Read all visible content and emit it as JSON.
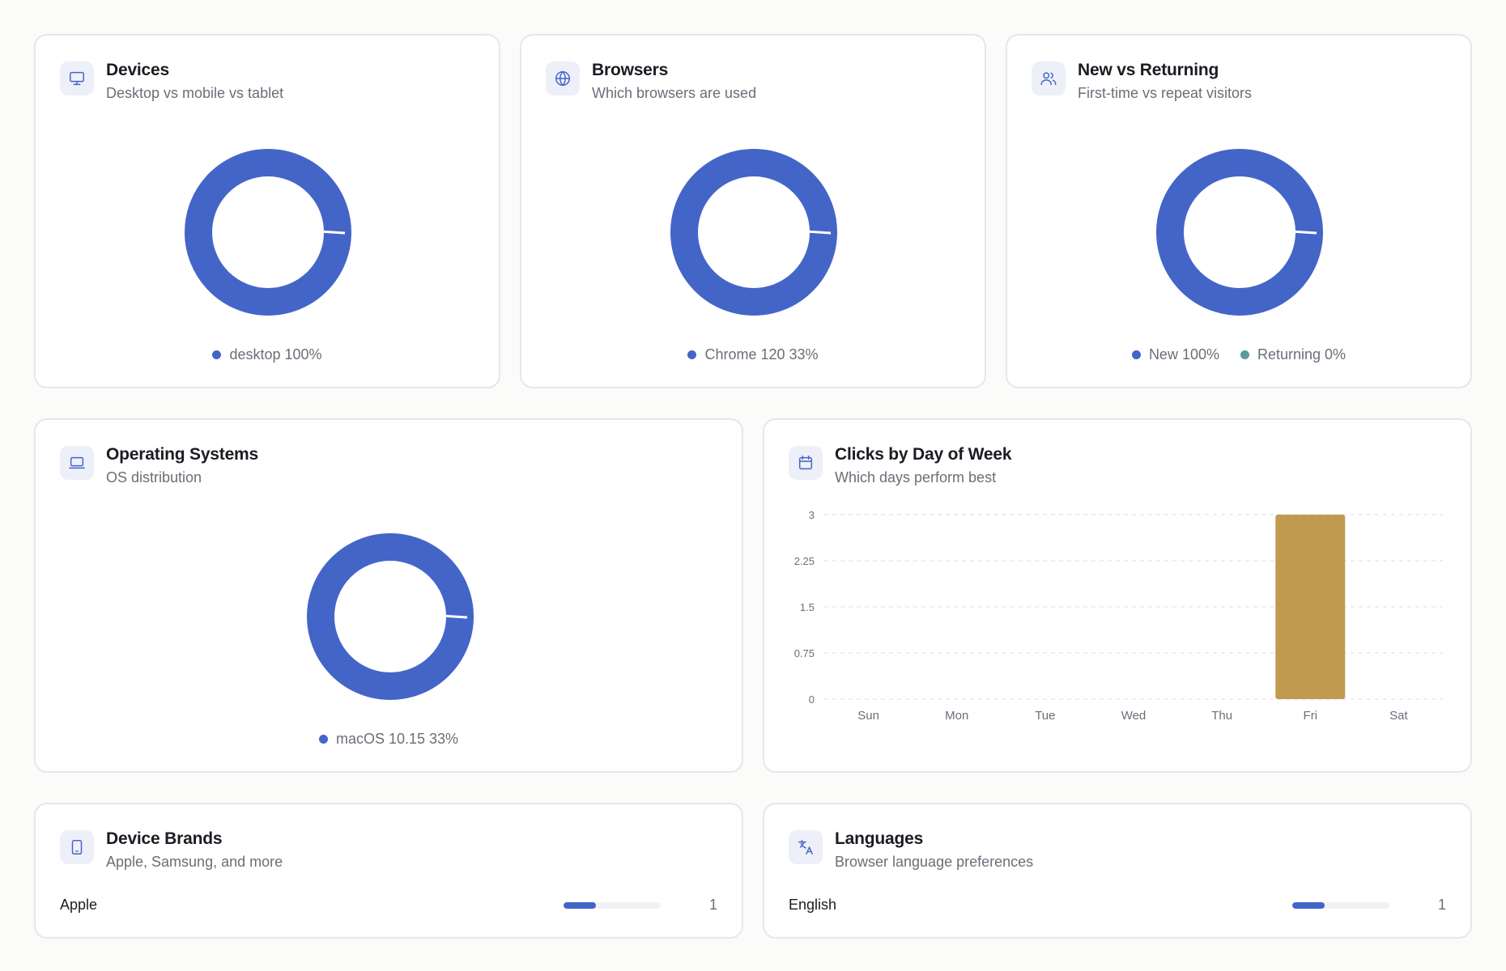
{
  "colors": {
    "primary": "#4465c8",
    "secondary": "#5a9aa0",
    "bar": "#c09a4e",
    "icon_bg": "#edf0f8"
  },
  "devices": {
    "title": "Devices",
    "subtitle": "Desktop vs mobile vs tablet",
    "icon": "monitor-icon",
    "legend": [
      {
        "label": "desktop 100%",
        "color": "#4465c8"
      }
    ],
    "chart_data": {
      "type": "pie",
      "labels": [
        "desktop"
      ],
      "values": [
        100
      ]
    }
  },
  "browsers": {
    "title": "Browsers",
    "subtitle": "Which browsers are used",
    "icon": "globe-icon",
    "legend": [
      {
        "label": "Chrome 120 33%",
        "color": "#4465c8"
      }
    ],
    "chart_data": {
      "type": "pie",
      "labels": [
        "Chrome 120"
      ],
      "values": [
        100
      ]
    }
  },
  "new_vs_returning": {
    "title": "New vs Returning",
    "subtitle": "First-time vs repeat visitors",
    "icon": "users-icon",
    "legend": [
      {
        "label": "New 100%",
        "color": "#4465c8"
      },
      {
        "label": "Returning 0%",
        "color": "#5a9aa0"
      }
    ],
    "chart_data": {
      "type": "pie",
      "labels": [
        "New",
        "Returning"
      ],
      "values": [
        100,
        0
      ]
    }
  },
  "operating_systems": {
    "title": "Operating Systems",
    "subtitle": "OS distribution",
    "icon": "laptop-icon",
    "legend": [
      {
        "label": "macOS 10.15 33%",
        "color": "#4465c8"
      }
    ],
    "chart_data": {
      "type": "pie",
      "labels": [
        "macOS 10.15"
      ],
      "values": [
        100
      ]
    }
  },
  "clicks_by_day": {
    "title": "Clicks by Day of Week",
    "subtitle": "Which days perform best",
    "icon": "calendar-icon",
    "chart_data": {
      "type": "bar",
      "categories": [
        "Sun",
        "Mon",
        "Tue",
        "Wed",
        "Thu",
        "Fri",
        "Sat"
      ],
      "values": [
        0,
        0,
        0,
        0,
        0,
        3,
        0
      ],
      "ylim": [
        0,
        3
      ],
      "yticks": [
        "0",
        "0.75",
        "1.5",
        "2.25",
        "3"
      ],
      "grid": true
    }
  },
  "device_brands": {
    "title": "Device Brands",
    "subtitle": "Apple, Samsung, and more",
    "icon": "tablet-icon",
    "rows": [
      {
        "label": "Apple",
        "value": "1",
        "fraction": 0.33
      }
    ]
  },
  "languages": {
    "title": "Languages",
    "subtitle": "Browser language preferences",
    "icon": "translate-icon",
    "rows": [
      {
        "label": "English",
        "value": "1",
        "fraction": 0.33
      }
    ]
  }
}
